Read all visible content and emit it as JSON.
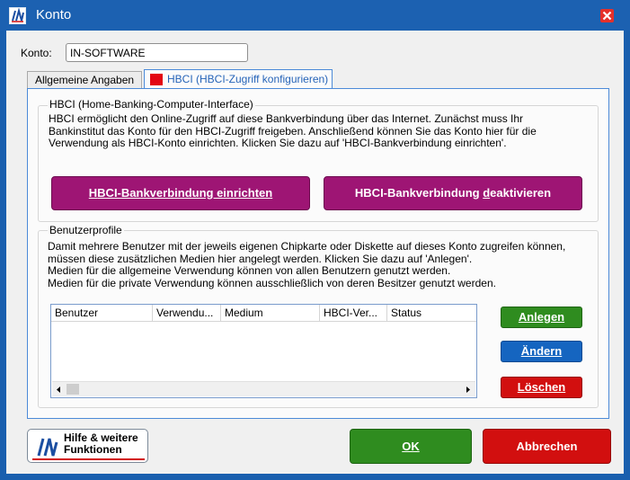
{
  "window": {
    "title": "Konto",
    "icon": "in-software-logo",
    "close_icon": "close-icon"
  },
  "konto": {
    "label": "Konto:",
    "value": "IN-SOFTWARE"
  },
  "tabs": [
    {
      "label": "Allgemeine Angaben",
      "active": false
    },
    {
      "label": "HBCI (HBCI-Zugriff konfigurieren)",
      "active": true,
      "flag_color": "#e30613"
    }
  ],
  "hbci_group": {
    "legend": "HBCI (Home-Banking-Computer-Interface)",
    "lines": [
      "HBCI ermöglicht den Online-Zugriff auf diese Bankverbindung über das Internet. Zunächst muss Ihr",
      "Bankinstitut das Konto für den HBCI-Zugriff freigeben. Anschließend können Sie das Konto hier für die",
      "Verwendung als HBCI-Konto einrichten. Klicken Sie dazu auf 'HBCI-Bankverbindung einrichten'."
    ],
    "setup_button": {
      "mnemonic": "H",
      "rest": "BCI-Bankverbindung einrichten"
    },
    "deactivate_button": {
      "before": "HBCI-Bankverbindung ",
      "mnemonic": "d",
      "after": "eaktivieren"
    }
  },
  "profiles_group": {
    "legend": "Benutzerprofile",
    "lines": [
      "Damit mehrere Benutzer mit der jeweils eigenen Chipkarte oder Diskette auf dieses Konto zugreifen können,",
      "müssen diese zusätzlichen Medien hier angelegt werden. Klicken Sie dazu auf 'Anlegen'.",
      "Medien für die allgemeine Verwendung können von allen Benutzern genutzt werden.",
      "Medien für die private Verwendung können ausschließlich von deren Besitzer genutzt werden."
    ],
    "columns": [
      "Benutzer",
      "Verwendu...",
      "Medium",
      "HBCI-Ver...",
      "Status"
    ],
    "rows": [],
    "buttons": {
      "add": "Anlegen",
      "edit": "Ändern",
      "delete": "Löschen"
    }
  },
  "footer": {
    "help_line1": "Hilfe & weitere",
    "help_line2": "Funktionen",
    "ok": "OK",
    "cancel": "Abbrechen"
  },
  "colors": {
    "title_bar": "#1c61b1",
    "magenta": "#9e1574",
    "green": "#2f8c1f",
    "blue": "#1565c0",
    "red": "#d20f0f"
  }
}
